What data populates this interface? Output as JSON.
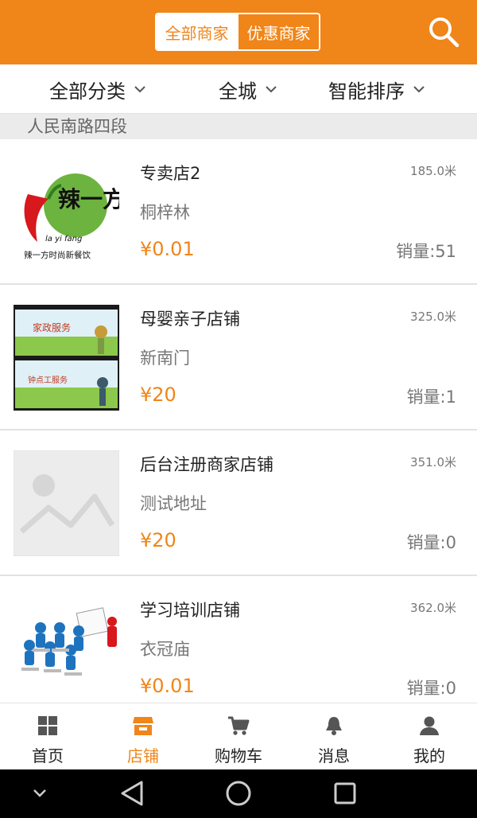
{
  "header": {
    "segments": [
      "全部商家",
      "优惠商家"
    ],
    "search_icon": "search-icon"
  },
  "filters": [
    "全部分类",
    "全城",
    "智能排序"
  ],
  "section_title": "人民南路四段",
  "stores": [
    {
      "name": "专卖店2",
      "address": "桐梓林",
      "price": "¥0.01",
      "distance": "185.0米",
      "sales": "销量:51",
      "logo_text": "辣一方",
      "logo_sub": "la yi fang",
      "logo_slogan": "辣一方时尚新餐饮"
    },
    {
      "name": "母婴亲子店铺",
      "address": "新南门",
      "price": "¥20",
      "distance": "325.0米",
      "sales": "销量:1",
      "banner_top": "家政服务",
      "banner_bottom": "钟点工服务"
    },
    {
      "name": "后台注册商家店铺",
      "address": "测试地址",
      "price": "¥20",
      "distance": "351.0米",
      "sales": "销量:0"
    },
    {
      "name": "学习培训店铺",
      "address": "衣冠庙",
      "price": "¥0.01",
      "distance": "362.0米",
      "sales": "销量:0"
    }
  ],
  "tabs": [
    {
      "label": "首页",
      "icon": "home-grid-icon"
    },
    {
      "label": "店铺",
      "icon": "store-icon"
    },
    {
      "label": "购物车",
      "icon": "cart-icon"
    },
    {
      "label": "消息",
      "icon": "bell-icon"
    },
    {
      "label": "我的",
      "icon": "user-icon"
    }
  ],
  "colors": {
    "accent": "#f08519",
    "text": "#222222",
    "secondary": "#777777",
    "divider": "#e2e2e2"
  }
}
